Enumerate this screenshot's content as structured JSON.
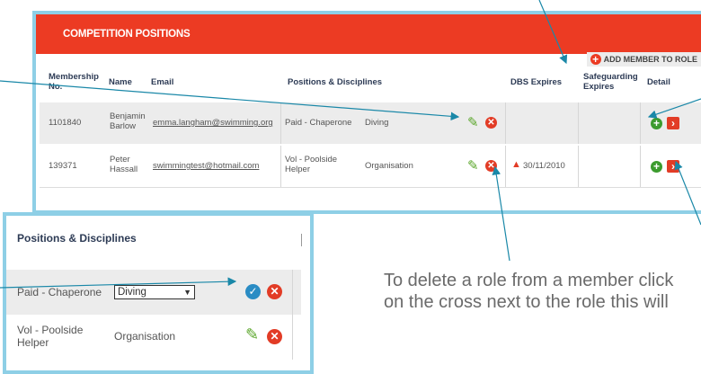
{
  "panel": {
    "title": "COMPETITION POSITIONS",
    "add_member": "ADD MEMBER TO ROLE",
    "columns": {
      "membership": "Membership No.",
      "name": "Name",
      "email": "Email",
      "positions": "Positions & Disciplines",
      "dbs": "DBS Expires",
      "safeguarding": "Safeguarding Expires",
      "detail": "Detail"
    },
    "rows": [
      {
        "membership": "1101840",
        "name": "Benjamin Barlow",
        "email": "emma.langham@swimming.org",
        "position": "Paid - Chaperone",
        "discipline": "Diving",
        "dbs": ""
      },
      {
        "membership": "139371",
        "name": "Peter Hassall",
        "email": "swimmingtest@hotmail.com",
        "position": "Vol - Poolside Helper",
        "discipline": "Organisation",
        "dbs": "30/11/2010"
      }
    ]
  },
  "inset": {
    "header": "Positions & Disciplines",
    "rows": [
      {
        "position": "Paid - Chaperone",
        "discipline": "Diving"
      },
      {
        "position": "Vol - Poolside Helper",
        "discipline": "Organisation"
      }
    ]
  },
  "caption": "To delete a role from a member click on the cross next to the role this will",
  "colors": {
    "brand_red": "#ec3b23",
    "panel_border": "#8ecfe6",
    "edit_green": "#5aa62a",
    "confirm_blue": "#2a8cc4",
    "arrow": "#1a88a8"
  },
  "icons": [
    "plus-circle-icon",
    "pencil-icon",
    "close-circle-icon",
    "chevron-right-icon",
    "warning-icon",
    "check-circle-icon",
    "dropdown-arrow-icon"
  ]
}
